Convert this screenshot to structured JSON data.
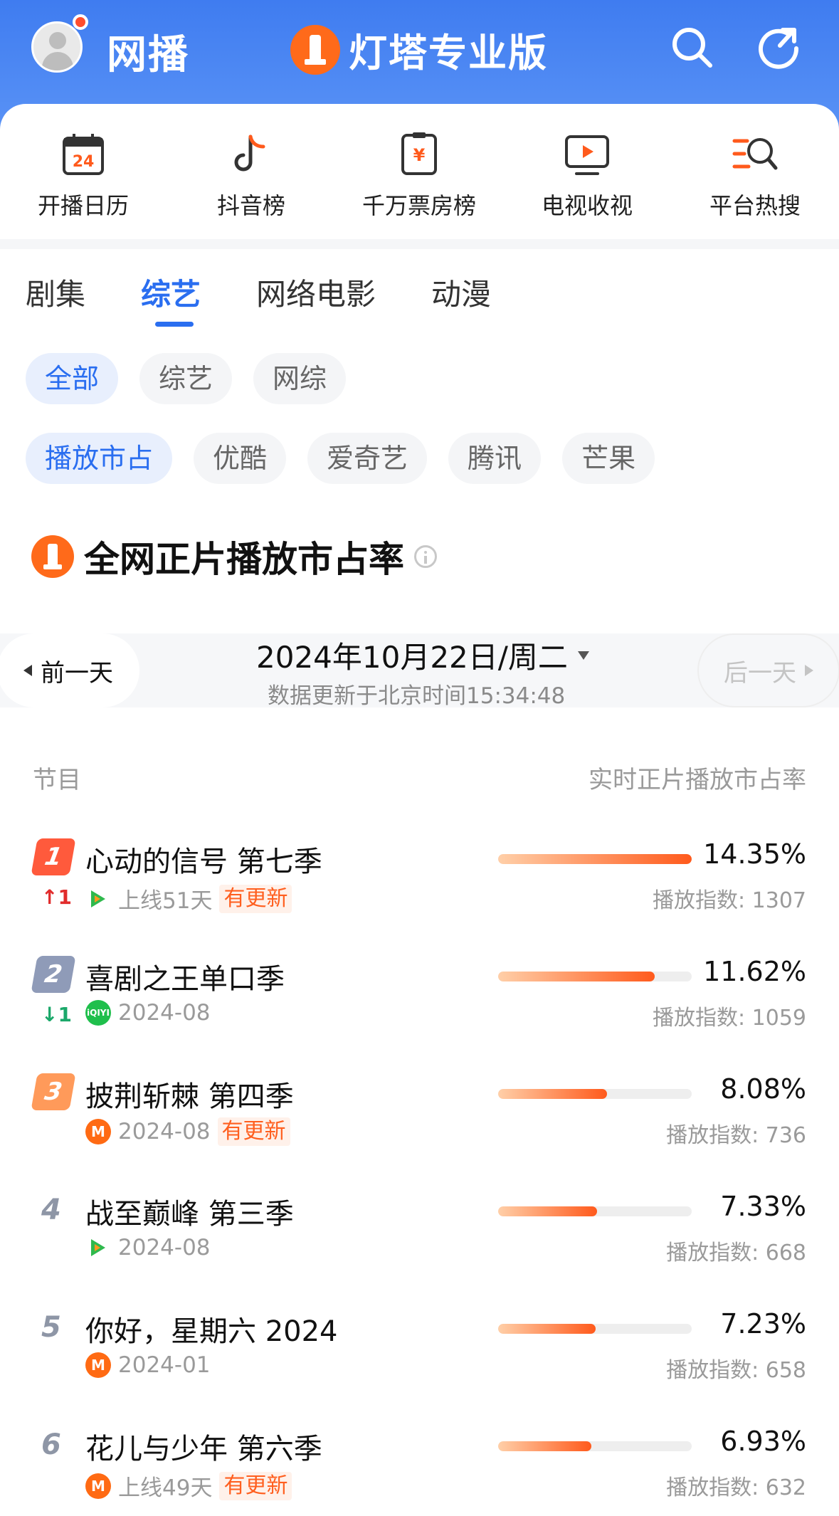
{
  "header": {
    "app_title": "网播",
    "brand": "灯塔专业版",
    "icons": [
      "search-icon",
      "share-icon"
    ]
  },
  "features": [
    {
      "label": "开播日历",
      "icon": "calendar-icon",
      "badge": "24"
    },
    {
      "label": "抖音榜",
      "icon": "douyin-icon"
    },
    {
      "label": "千万票房榜",
      "icon": "ticket-icon",
      "badge": "¥"
    },
    {
      "label": "电视收视",
      "icon": "tv-icon"
    },
    {
      "label": "平台热搜",
      "icon": "hot-search-icon"
    }
  ],
  "tabs": [
    "剧集",
    "综艺",
    "网络电影",
    "动漫"
  ],
  "active_tab": "综艺",
  "chips_type": [
    "全部",
    "综艺",
    "网综"
  ],
  "chips_platform": [
    "播放市占",
    "优酷",
    "爱奇艺",
    "腾讯",
    "芒果"
  ],
  "section_title": "全网正片播放市占率",
  "date": {
    "prev": "前一天",
    "current": "2024年10月22日/周二",
    "updated": "数据更新于北京时间15:34:48",
    "next": "后一天"
  },
  "table_header": {
    "left": "节目",
    "right": "实时正片播放市占率"
  },
  "rows": [
    {
      "rank": "1",
      "trend": "↑1",
      "trend_dir": "up",
      "title": "心动的信号 第七季",
      "platform": "tencent",
      "meta": "上线51天",
      "update": "有更新",
      "share": "14.35%",
      "share_value": 14.35,
      "index": "播放指数: 1307"
    },
    {
      "rank": "2",
      "trend": "↓1",
      "trend_dir": "down",
      "title": "喜剧之王单口季",
      "platform": "iqiyi",
      "meta": "2024-08",
      "update": "",
      "share": "11.62%",
      "share_value": 11.62,
      "index": "播放指数: 1059"
    },
    {
      "rank": "3",
      "trend": "",
      "trend_dir": "",
      "title": "披荆斩棘 第四季",
      "platform": "mango",
      "meta": "2024-08",
      "update": "有更新",
      "share": "8.08%",
      "share_value": 8.08,
      "index": "播放指数: 736"
    },
    {
      "rank": "4",
      "trend": "",
      "trend_dir": "",
      "title": "战至巅峰 第三季",
      "platform": "tencent",
      "meta": "2024-08",
      "update": "",
      "share": "7.33%",
      "share_value": 7.33,
      "index": "播放指数: 668"
    },
    {
      "rank": "5",
      "trend": "",
      "trend_dir": "",
      "title": "你好，星期六 2024",
      "platform": "mango",
      "meta": "2024-01",
      "update": "",
      "share": "7.23%",
      "share_value": 7.23,
      "index": "播放指数: 658"
    },
    {
      "rank": "6",
      "trend": "",
      "trend_dir": "",
      "title": "花儿与少年 第六季",
      "platform": "mango",
      "meta": "上线49天",
      "update": "有更新",
      "share": "6.93%",
      "share_value": 6.93,
      "index": "播放指数: 632"
    }
  ],
  "colors": {
    "header_blue": "#3f7cf0",
    "accent_blue": "#2a6ef0",
    "bar_orange": "#ff5a1c",
    "rank1": "#ff5a3c",
    "rank2": "#8f9bb8",
    "rank3": "#ff9a5a"
  }
}
